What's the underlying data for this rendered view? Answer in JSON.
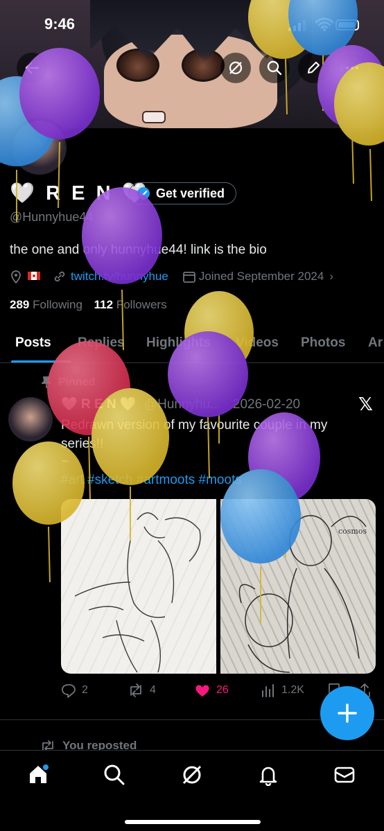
{
  "status_bar": {
    "time": "9:46"
  },
  "profile": {
    "name": "R E N",
    "verify_label": "Get verified",
    "handle": "@Hunnyhue44",
    "bio": "the one and only hunnyhue44! link is the bio",
    "link": "twitch.tv/hunnyhue",
    "joined": "Joined September 2024",
    "following_count": "289",
    "following_label": "Following",
    "followers_count": "112",
    "followers_label": "Followers"
  },
  "tabs": [
    "Posts",
    "Replies",
    "Highlights",
    "Videos",
    "Photos",
    "Ar"
  ],
  "post": {
    "pinned_label": "Pinned",
    "author_name": "R E N",
    "author_handle": "@Hunnyhu...",
    "date": "· 2026-02-20",
    "text": "Redrawn version of my favourite couple in my series!!",
    "tilde": "~",
    "tags": "#art #sketch #artmoots #moots",
    "replies": "2",
    "reposts": "4",
    "likes": "26",
    "views": "1.2K"
  },
  "next_item": {
    "reposted_label": "You reposted"
  },
  "colors": {
    "accent": "#1d9bf0",
    "like": "#f91880",
    "muted": "#71767b"
  }
}
